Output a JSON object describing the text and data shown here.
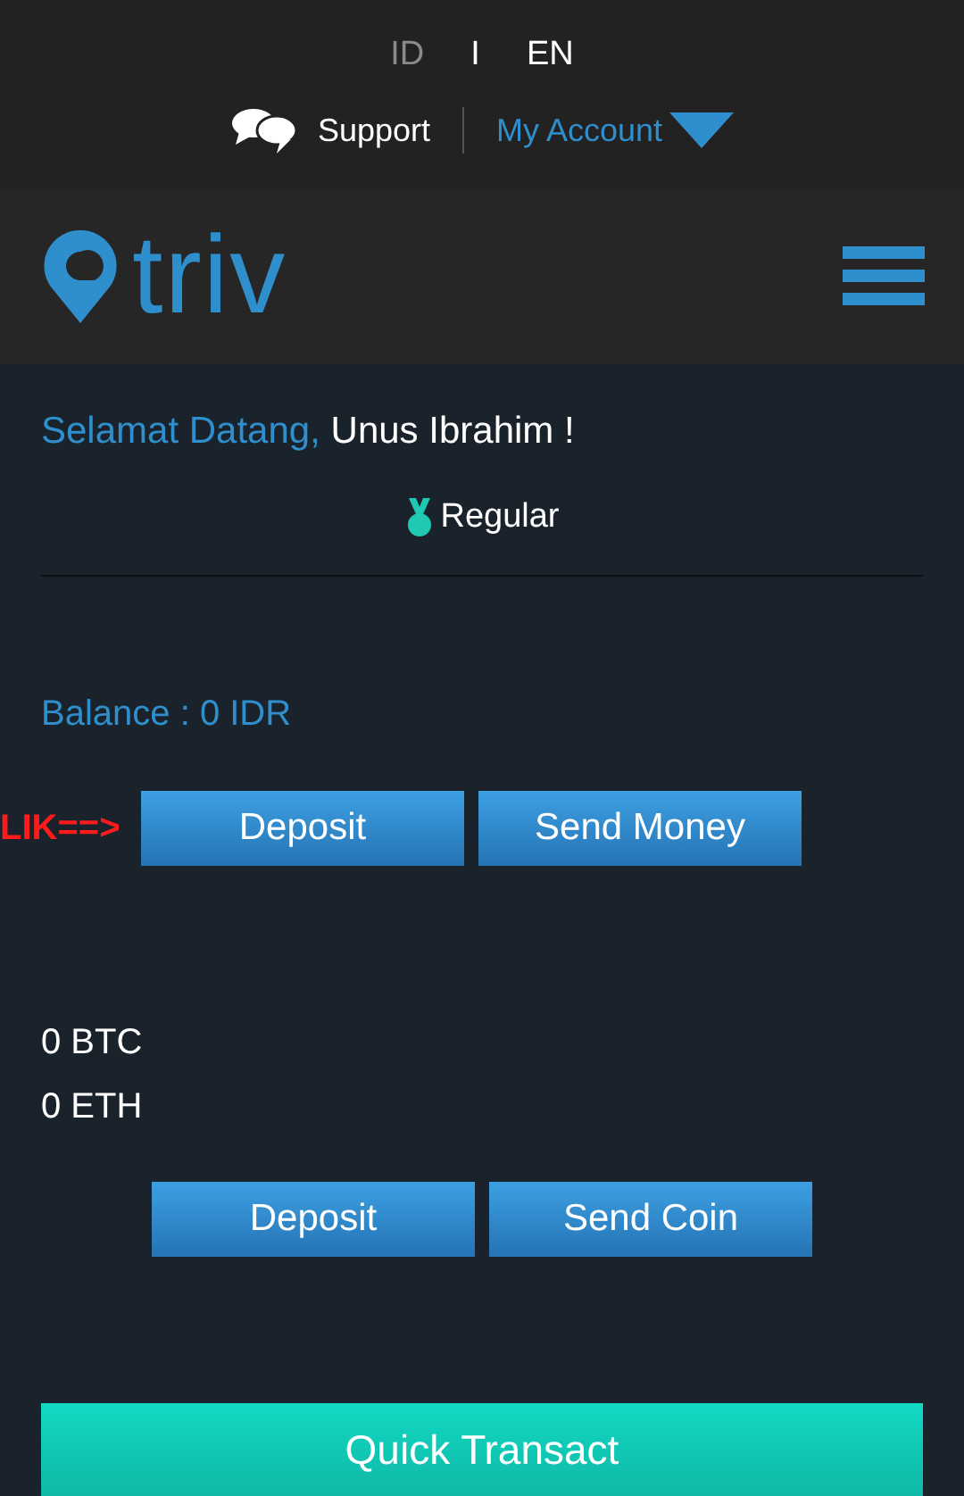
{
  "languages": [
    {
      "label": "ID",
      "selected": false
    },
    {
      "label": "EN",
      "selected": true
    }
  ],
  "language_separator": "I",
  "top_links": {
    "support": "Support",
    "account": "My Account"
  },
  "logo": {
    "text": "triv"
  },
  "welcome": {
    "greeting": "Selamat Datang,",
    "name": "Unus Ibrahim !",
    "tier": "Regular"
  },
  "balance": "Balance : 0 IDR",
  "annotation": "LIK==>",
  "fiat_buttons": [
    "Deposit",
    "Send Money"
  ],
  "coins": [
    "0 BTC",
    "0 ETH"
  ],
  "coin_buttons": [
    "Deposit",
    "Send Coin"
  ],
  "quick_button": "Quick Transact"
}
